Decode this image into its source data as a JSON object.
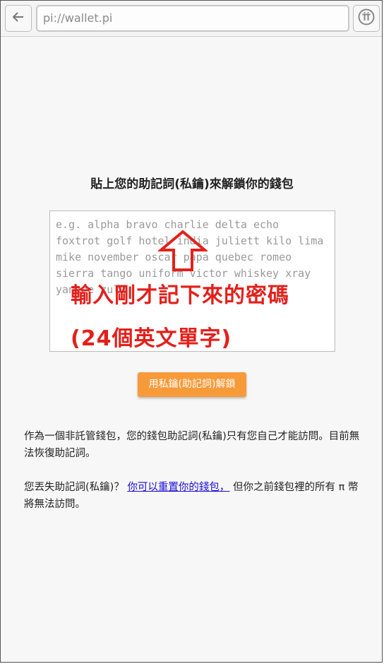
{
  "browser": {
    "url": "pi://wallet.pi",
    "back_icon": "arrow-left-icon",
    "pi_icon": "pi-logo-icon"
  },
  "main": {
    "title": "貼上您的助記詞(私鑰)來解鎖你的錢包",
    "placeholder": "e.g. alpha bravo charlie delta echo foxtrot golf hotel india juliett kilo lima mike november oscar papa quebec romeo sierra tango uniform victor whiskey xray yankee zulu",
    "unlock_button": "用私鑰(助記詞)解鎖",
    "info_text": "作為一個非託管錢包，您的錢包助記詞(私鑰)只有您自己才能訪問。目前無法恢復助記詞。",
    "lost_prefix": "您丟失助記詞(私鑰)？ ",
    "reset_link": "你可以重置你的錢包，",
    "lost_suffix": " 但你之前錢包裡的所有 π 幣將無法訪問。"
  },
  "annotation": {
    "line1": "輸入剛才記下來的密碼",
    "line2": "(24個英文單字)",
    "color": "#e3201b"
  },
  "colors": {
    "button": "#f79a3a",
    "link": "#1a0dd8"
  }
}
